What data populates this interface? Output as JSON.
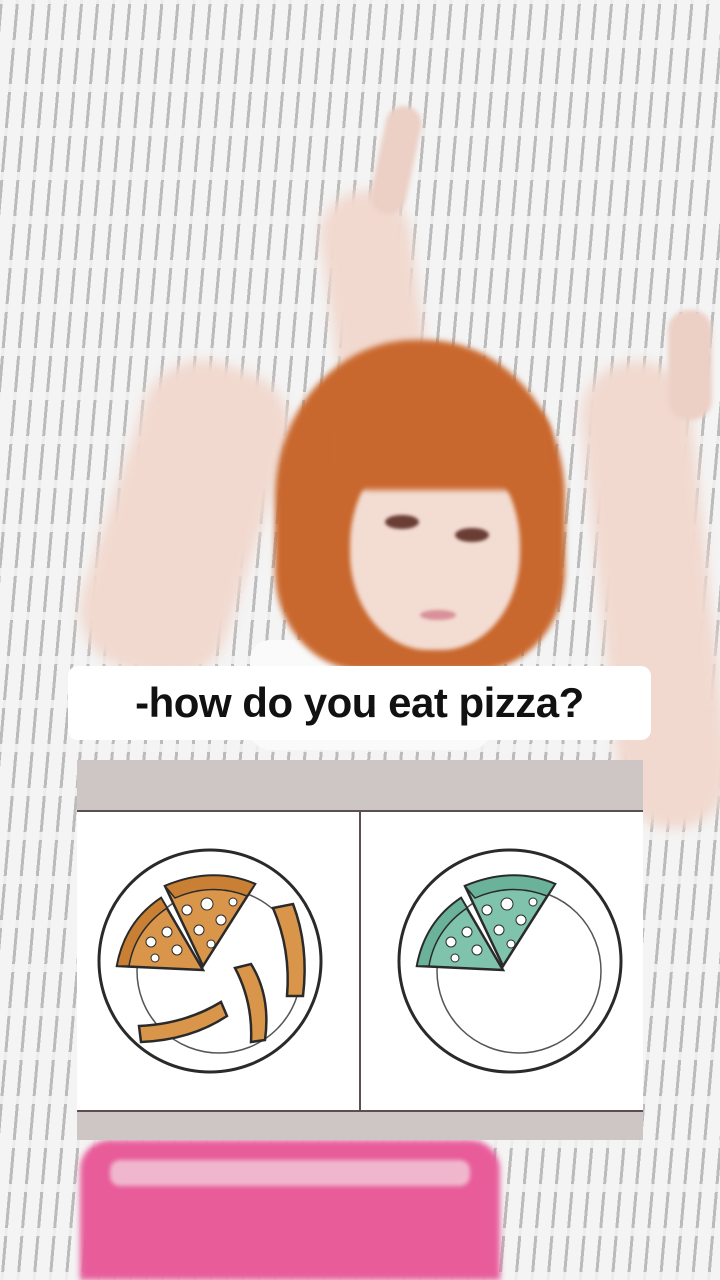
{
  "caption": {
    "question": "-how do you eat pizza?"
  },
  "illustration": {
    "left_option": {
      "icon": "pizza-plate-with-crusts-icon",
      "color": "#d9964a"
    },
    "right_option": {
      "icon": "pizza-plate-clean-icon",
      "color": "#7fc3ad"
    }
  },
  "colors": {
    "hair": "#c9682e",
    "pants": "#e85c9a",
    "panel_frame": "#cdc6c4"
  }
}
